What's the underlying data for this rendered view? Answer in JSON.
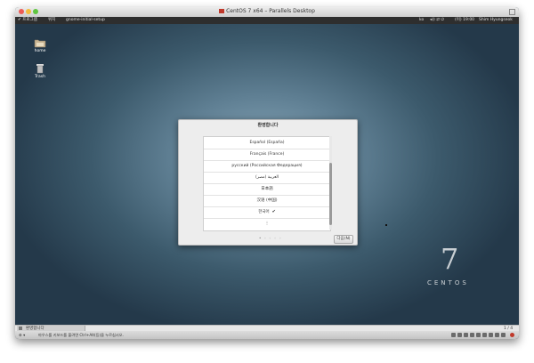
{
  "window": {
    "title": "CentOS 7 x64 – Parallels Desktop"
  },
  "gnome_bar": {
    "apps": "✔ 프로그램",
    "places": "위치",
    "app_name": "gnome-initial-setup",
    "lang": "ko",
    "clock": "(이) 19:00",
    "user": "Shim Hyungseok"
  },
  "desktop": {
    "icons": [
      {
        "label": "home"
      },
      {
        "label": "Trash"
      }
    ],
    "logo": {
      "number": "7",
      "text": "CENTOS"
    }
  },
  "dialog": {
    "title": "환영합니다",
    "languages": [
      {
        "label": "Español (España)",
        "selected": false
      },
      {
        "label": "Français (France)",
        "selected": false
      },
      {
        "label": "русский (Российская Федерация)",
        "selected": false
      },
      {
        "label": "العربية (مصر)",
        "selected": false
      },
      {
        "label": "日本語",
        "selected": false
      },
      {
        "label": "汉语 (中国)",
        "selected": false
      },
      {
        "label": "한국어",
        "selected": true
      },
      {
        "label": "⋮",
        "selected": false
      }
    ],
    "pager": "• ◦ ◦ ◦ ◦",
    "next_label": "다음(N)"
  },
  "taskbar": {
    "item": "환영합니다",
    "workspace": "1 / 4"
  },
  "statusbar": {
    "message": "마우스를 키보드를 풀려면 Ctrl+Alt(등)을 누르십시오."
  },
  "colors": {
    "accent": "#c0392b"
  }
}
